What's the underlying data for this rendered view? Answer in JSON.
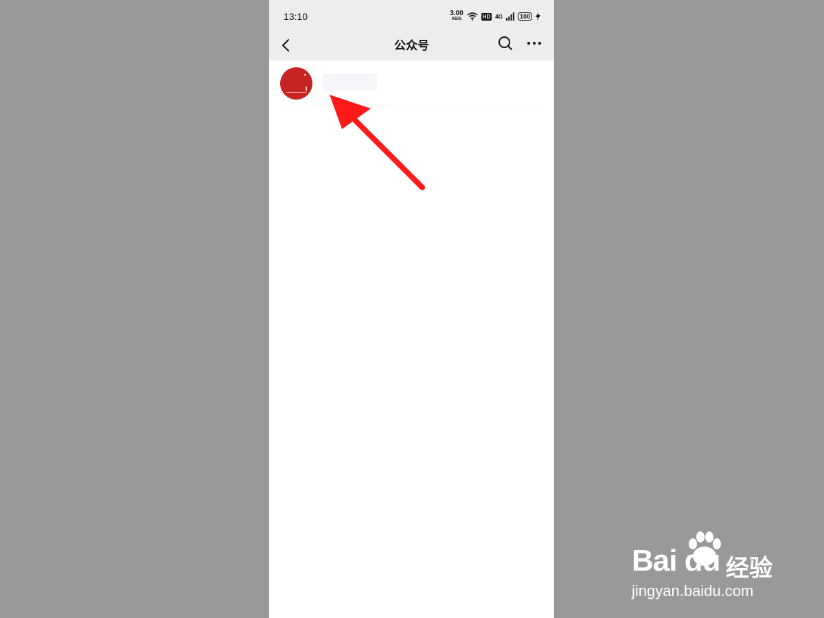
{
  "status_bar": {
    "time": "13:10",
    "speed_value": "3.00",
    "speed_unit": "KB/S",
    "hd_label": "HD",
    "network_label": "4G",
    "battery_level": "100"
  },
  "navbar": {
    "title": "公众号",
    "icons": [
      "chevron-left-icon",
      "search-icon",
      "more-icon"
    ]
  },
  "accounts": [
    {
      "avatar_color": "#c52422"
    }
  ],
  "annotation": {
    "arrow_color": "#ff1a1a"
  },
  "watermark": {
    "brand": "Bai  du",
    "brand_cn": "经验",
    "url": "jingyan.baidu.com"
  }
}
